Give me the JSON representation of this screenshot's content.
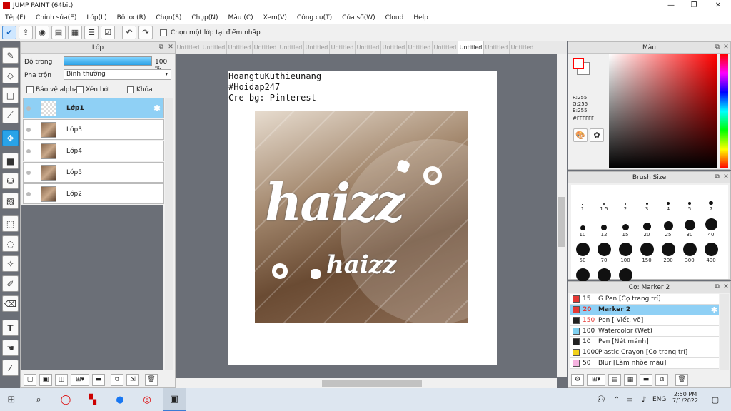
{
  "window": {
    "title": "JUMP PAINT (64bit)",
    "minimize_glyph": "—",
    "restore_glyph": "❐",
    "close_glyph": "✕"
  },
  "menu": [
    "Tệp(F)",
    "Chỉnh sửa(E)",
    "Lớp(L)",
    "Bộ lọc(R)",
    "Chọn(S)",
    "Chụp(N)",
    "Màu (C)",
    "Xem(V)",
    "Công cụ(T)",
    "Cửa sổ(W)",
    "Cloud",
    "Help"
  ],
  "toolbar": {
    "checkbox_label": "Chọn một lớp tại điểm nhấp"
  },
  "layer_panel": {
    "title": "Lớp",
    "opacity_label": "Độ trong",
    "opacity_value": "100 %",
    "opacity_fraction": 1.0,
    "blend_label": "Pha trộn",
    "blend_value": "Bình thường",
    "protect_alpha": "Bảo vệ alpha",
    "clip": "Xén bớt",
    "lock": "Khóa",
    "layers": [
      "Lớp1",
      "Lớp3",
      "Lớp4",
      "Lớp5",
      "Lớp2"
    ]
  },
  "canvas": {
    "tabs": [
      "Untitled",
      "Untitled",
      "Untitled",
      "Untitled",
      "Untitled",
      "Untitled",
      "Untitled",
      "Untitled",
      "Untitled",
      "Untitled",
      "Untitled",
      "Untitled",
      "Untitled",
      "Untitled"
    ],
    "active_tab_index": 11,
    "text_lines": [
      "HoangtuKuthieunang",
      "#Hoidap247",
      "Cre bg: Pinterest"
    ],
    "art_big": "haizz",
    "art_small": "haizz"
  },
  "color_panel": {
    "title": "Màu",
    "r": "R:255",
    "g": "G:255",
    "b": "B:255",
    "hex": "#FFFFFF",
    "main_color": "#ff0000"
  },
  "brush_panel": {
    "title": "Brush Size",
    "sizes": [
      "1",
      "1.5",
      "2",
      "3",
      "4",
      "5",
      "7",
      "10",
      "12",
      "15",
      "20",
      "25",
      "30",
      "40",
      "50",
      "70",
      "100",
      "150",
      "200",
      "300",
      "400",
      "",
      "",
      ""
    ]
  },
  "tool_panel": {
    "title": "Cọ: Marker 2",
    "tools": [
      {
        "size": "15",
        "name": "G Pen [Cọ trang trí]",
        "color": "#e53935"
      },
      {
        "size": "20",
        "name": "Marker 2",
        "color": "#e53935"
      },
      {
        "size": "150",
        "name": "Pen [ Viết, vẽ]",
        "color": "#222222"
      },
      {
        "size": "100",
        "name": "Watercolor (Wet)",
        "color": "#7fd0f0"
      },
      {
        "size": "10",
        "name": "Pen [Nét mảnh]",
        "color": "#222222"
      },
      {
        "size": "1000",
        "name": "Plastic Crayon [Cọ trang trí]",
        "color": "#f2d21b"
      },
      {
        "size": "50",
        "name": "Blur [Làm nhòe màu]",
        "color": "#f6b3e0"
      }
    ]
  },
  "taskbar": {
    "time": "2:50 PM",
    "date": "7/1/2022",
    "lang": "ENG"
  }
}
